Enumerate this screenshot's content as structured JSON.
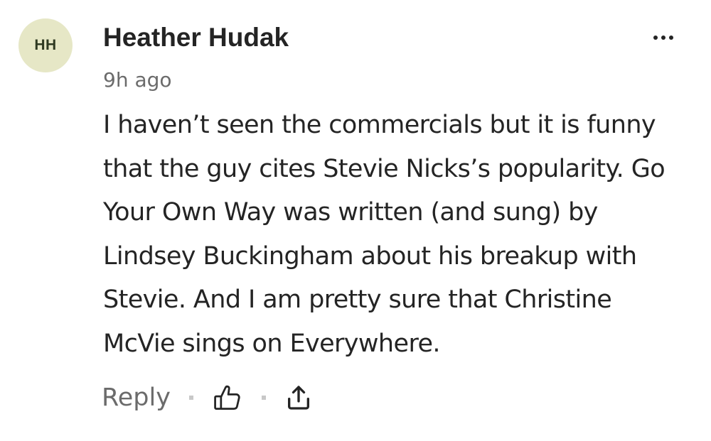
{
  "comment": {
    "avatar": {
      "initials": "HH",
      "bg_color": "#e6e7c6"
    },
    "author": "Heather Hudak",
    "timestamp": "9h ago",
    "text_lines": [
      "I haven’t seen the commercials but it is funny",
      "that the guy cites Stevie Nicks’s popularity. Go",
      "Your Own Way was written (and sung) by",
      "Lindsey Buckingham about his breakup with",
      "Stevie. And I am pretty sure that Christine",
      "McVie sings on Everywhere."
    ],
    "actions": {
      "reply_label": "Reply",
      "clap_icon": "thumbs-up-icon",
      "share_icon": "share-icon",
      "more_icon": "more-horizontal-icon"
    }
  }
}
